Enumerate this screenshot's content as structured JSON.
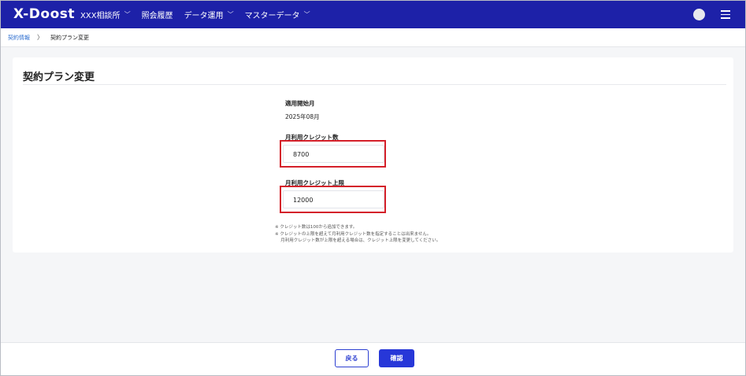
{
  "header": {
    "logo_text": "X-Doost",
    "nav": [
      {
        "label": "XXX相談所",
        "has_dropdown": true
      },
      {
        "label": "照会履歴",
        "has_dropdown": false
      },
      {
        "label": "データ運用",
        "has_dropdown": true
      },
      {
        "label": "マスターデータ",
        "has_dropdown": true
      }
    ],
    "dropdown_glyph": "﹀",
    "colors": {
      "bar": "#1d21a8",
      "accent": "#2737d8",
      "highlight": "#d4202a"
    }
  },
  "breadcrumb": {
    "parent": "契約情報",
    "separator": "〉",
    "current": "契約プラン変更"
  },
  "page": {
    "title": "契約プラン変更",
    "start_month": {
      "label": "適用開始月",
      "value": "2025年08月"
    },
    "monthly_credits": {
      "label": "月利用クレジット数",
      "value": "8700"
    },
    "credit_limit": {
      "label": "月利用クレジット上限",
      "value": "12000"
    },
    "notes": [
      "※ クレジット数は100から追加できます。",
      "※ クレジットの上限を超えて月利用クレジット数を指定することは出来ません。",
      "　 月利用クレジット数が上限を超える場合は、クレジット上限を変更してください。"
    ]
  },
  "footer": {
    "back_label": "戻る",
    "confirm_label": "確認"
  }
}
